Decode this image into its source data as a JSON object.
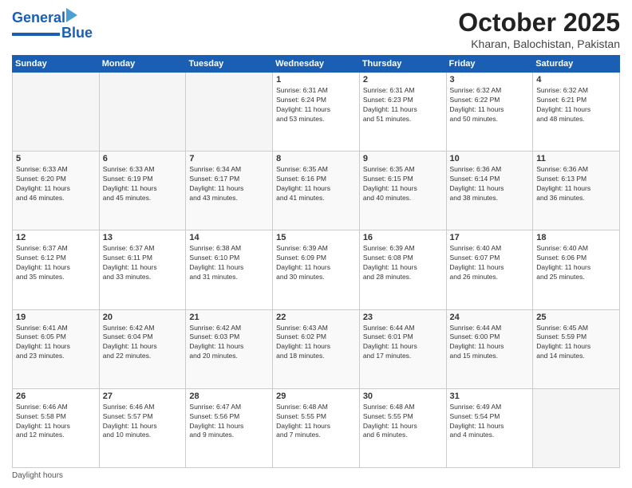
{
  "header": {
    "logo_general": "General",
    "logo_blue": "Blue",
    "month": "October 2025",
    "location": "Kharan, Balochistan, Pakistan"
  },
  "weekdays": [
    "Sunday",
    "Monday",
    "Tuesday",
    "Wednesday",
    "Thursday",
    "Friday",
    "Saturday"
  ],
  "footer": {
    "daylight_label": "Daylight hours"
  },
  "days": [
    {
      "num": "",
      "info": ""
    },
    {
      "num": "",
      "info": ""
    },
    {
      "num": "",
      "info": ""
    },
    {
      "num": "1",
      "info": "Sunrise: 6:31 AM\nSunset: 6:24 PM\nDaylight: 11 hours\nand 53 minutes."
    },
    {
      "num": "2",
      "info": "Sunrise: 6:31 AM\nSunset: 6:23 PM\nDaylight: 11 hours\nand 51 minutes."
    },
    {
      "num": "3",
      "info": "Sunrise: 6:32 AM\nSunset: 6:22 PM\nDaylight: 11 hours\nand 50 minutes."
    },
    {
      "num": "4",
      "info": "Sunrise: 6:32 AM\nSunset: 6:21 PM\nDaylight: 11 hours\nand 48 minutes."
    },
    {
      "num": "5",
      "info": "Sunrise: 6:33 AM\nSunset: 6:20 PM\nDaylight: 11 hours\nand 46 minutes."
    },
    {
      "num": "6",
      "info": "Sunrise: 6:33 AM\nSunset: 6:19 PM\nDaylight: 11 hours\nand 45 minutes."
    },
    {
      "num": "7",
      "info": "Sunrise: 6:34 AM\nSunset: 6:17 PM\nDaylight: 11 hours\nand 43 minutes."
    },
    {
      "num": "8",
      "info": "Sunrise: 6:35 AM\nSunset: 6:16 PM\nDaylight: 11 hours\nand 41 minutes."
    },
    {
      "num": "9",
      "info": "Sunrise: 6:35 AM\nSunset: 6:15 PM\nDaylight: 11 hours\nand 40 minutes."
    },
    {
      "num": "10",
      "info": "Sunrise: 6:36 AM\nSunset: 6:14 PM\nDaylight: 11 hours\nand 38 minutes."
    },
    {
      "num": "11",
      "info": "Sunrise: 6:36 AM\nSunset: 6:13 PM\nDaylight: 11 hours\nand 36 minutes."
    },
    {
      "num": "12",
      "info": "Sunrise: 6:37 AM\nSunset: 6:12 PM\nDaylight: 11 hours\nand 35 minutes."
    },
    {
      "num": "13",
      "info": "Sunrise: 6:37 AM\nSunset: 6:11 PM\nDaylight: 11 hours\nand 33 minutes."
    },
    {
      "num": "14",
      "info": "Sunrise: 6:38 AM\nSunset: 6:10 PM\nDaylight: 11 hours\nand 31 minutes."
    },
    {
      "num": "15",
      "info": "Sunrise: 6:39 AM\nSunset: 6:09 PM\nDaylight: 11 hours\nand 30 minutes."
    },
    {
      "num": "16",
      "info": "Sunrise: 6:39 AM\nSunset: 6:08 PM\nDaylight: 11 hours\nand 28 minutes."
    },
    {
      "num": "17",
      "info": "Sunrise: 6:40 AM\nSunset: 6:07 PM\nDaylight: 11 hours\nand 26 minutes."
    },
    {
      "num": "18",
      "info": "Sunrise: 6:40 AM\nSunset: 6:06 PM\nDaylight: 11 hours\nand 25 minutes."
    },
    {
      "num": "19",
      "info": "Sunrise: 6:41 AM\nSunset: 6:05 PM\nDaylight: 11 hours\nand 23 minutes."
    },
    {
      "num": "20",
      "info": "Sunrise: 6:42 AM\nSunset: 6:04 PM\nDaylight: 11 hours\nand 22 minutes."
    },
    {
      "num": "21",
      "info": "Sunrise: 6:42 AM\nSunset: 6:03 PM\nDaylight: 11 hours\nand 20 minutes."
    },
    {
      "num": "22",
      "info": "Sunrise: 6:43 AM\nSunset: 6:02 PM\nDaylight: 11 hours\nand 18 minutes."
    },
    {
      "num": "23",
      "info": "Sunrise: 6:44 AM\nSunset: 6:01 PM\nDaylight: 11 hours\nand 17 minutes."
    },
    {
      "num": "24",
      "info": "Sunrise: 6:44 AM\nSunset: 6:00 PM\nDaylight: 11 hours\nand 15 minutes."
    },
    {
      "num": "25",
      "info": "Sunrise: 6:45 AM\nSunset: 5:59 PM\nDaylight: 11 hours\nand 14 minutes."
    },
    {
      "num": "26",
      "info": "Sunrise: 6:46 AM\nSunset: 5:58 PM\nDaylight: 11 hours\nand 12 minutes."
    },
    {
      "num": "27",
      "info": "Sunrise: 6:46 AM\nSunset: 5:57 PM\nDaylight: 11 hours\nand 10 minutes."
    },
    {
      "num": "28",
      "info": "Sunrise: 6:47 AM\nSunset: 5:56 PM\nDaylight: 11 hours\nand 9 minutes."
    },
    {
      "num": "29",
      "info": "Sunrise: 6:48 AM\nSunset: 5:55 PM\nDaylight: 11 hours\nand 7 minutes."
    },
    {
      "num": "30",
      "info": "Sunrise: 6:48 AM\nSunset: 5:55 PM\nDaylight: 11 hours\nand 6 minutes."
    },
    {
      "num": "31",
      "info": "Sunrise: 6:49 AM\nSunset: 5:54 PM\nDaylight: 11 hours\nand 4 minutes."
    },
    {
      "num": "",
      "info": ""
    }
  ]
}
